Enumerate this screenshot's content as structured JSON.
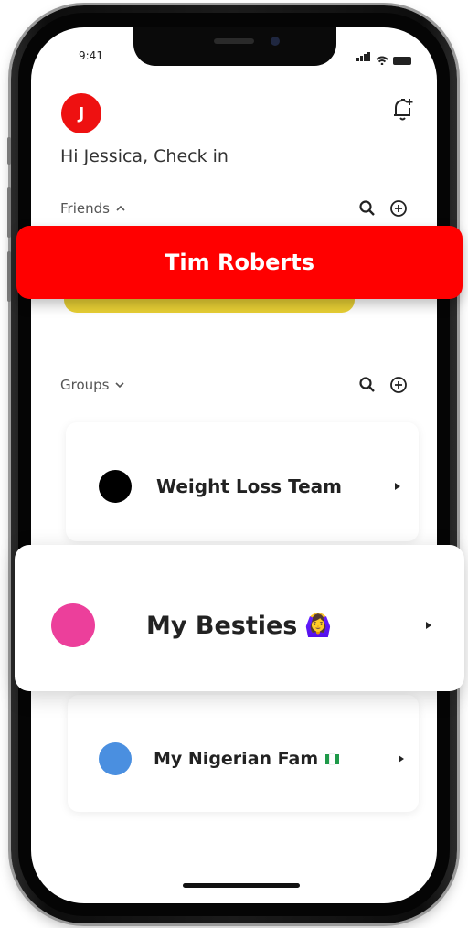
{
  "status_bar": {
    "time": "9:41"
  },
  "header": {
    "avatar_initial": "J",
    "greeting": "Hi Jessica, Check in"
  },
  "friends": {
    "section_label": "Friends",
    "highlighted_friend": "Tim Roberts"
  },
  "groups": {
    "section_label": "Groups",
    "items": [
      {
        "name": "Weight Loss Team",
        "color": "#000000"
      },
      {
        "name": "My Besties",
        "color": "#ec3f9b",
        "emoji": "🙆‍♀️"
      },
      {
        "name": "My Nigerian Fam",
        "color": "#4a8fe0"
      }
    ]
  },
  "colors": {
    "accent": "#ff0000",
    "green": "#1f9a4a",
    "yellow": "#e8d034"
  }
}
